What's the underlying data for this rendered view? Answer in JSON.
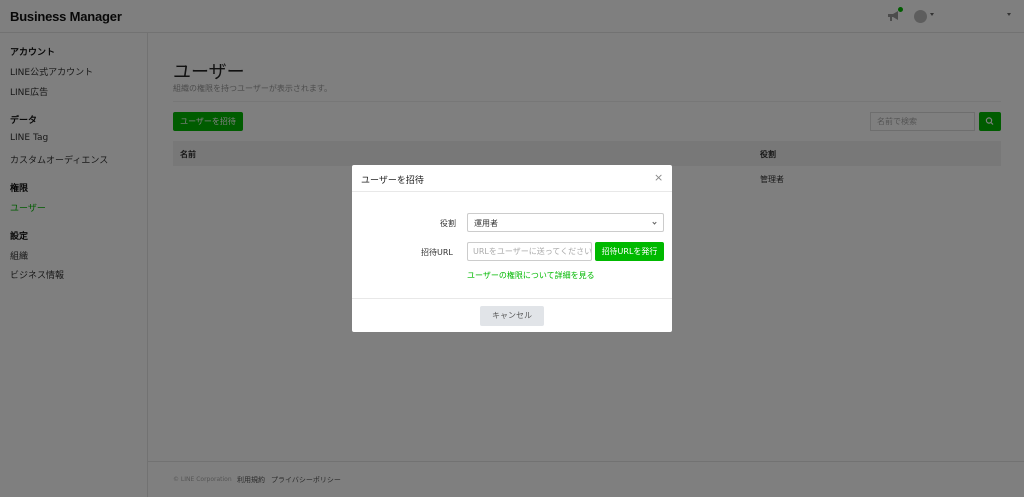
{
  "header": {
    "app_title": "Business Manager",
    "notification_dot_color": "#00b900"
  },
  "sidebar": {
    "sections": [
      {
        "title": "アカウント",
        "items": [
          "LINE公式アカウント",
          "LINE広告"
        ]
      },
      {
        "title": "データ",
        "items": [
          "LINE Tag",
          "カスタムオーディエンス"
        ]
      },
      {
        "title": "権限",
        "items": [
          "ユーザー"
        ]
      },
      {
        "title": "設定",
        "items": [
          "組織",
          "ビジネス情報"
        ]
      }
    ],
    "active_item": "ユーザー"
  },
  "main": {
    "title": "ユーザー",
    "subtitle": "組織の権限を持つユーザーが表示されます。",
    "invite_button": "ユーザーを招待",
    "search_placeholder": "名前で検索",
    "table": {
      "columns": [
        "名前",
        "役割"
      ],
      "rows": [
        {
          "name": "",
          "role": "管理者"
        }
      ]
    }
  },
  "footer": {
    "copyright": "© LINE Corporation",
    "links": [
      "利用規約",
      "プライバシーポリシー"
    ]
  },
  "modal": {
    "title": "ユーザーを招待",
    "role_label": "役割",
    "role_value": "運用者",
    "url_label": "招待URL",
    "url_placeholder": "URLをユーザーに送ってください",
    "issue_button": "招待URLを発行",
    "permission_link": "ユーザーの権限について詳細を見る",
    "cancel_button": "キャンセル"
  },
  "colors": {
    "accent": "#00b900",
    "overlay": "rgba(0,0,0,0.5)"
  }
}
